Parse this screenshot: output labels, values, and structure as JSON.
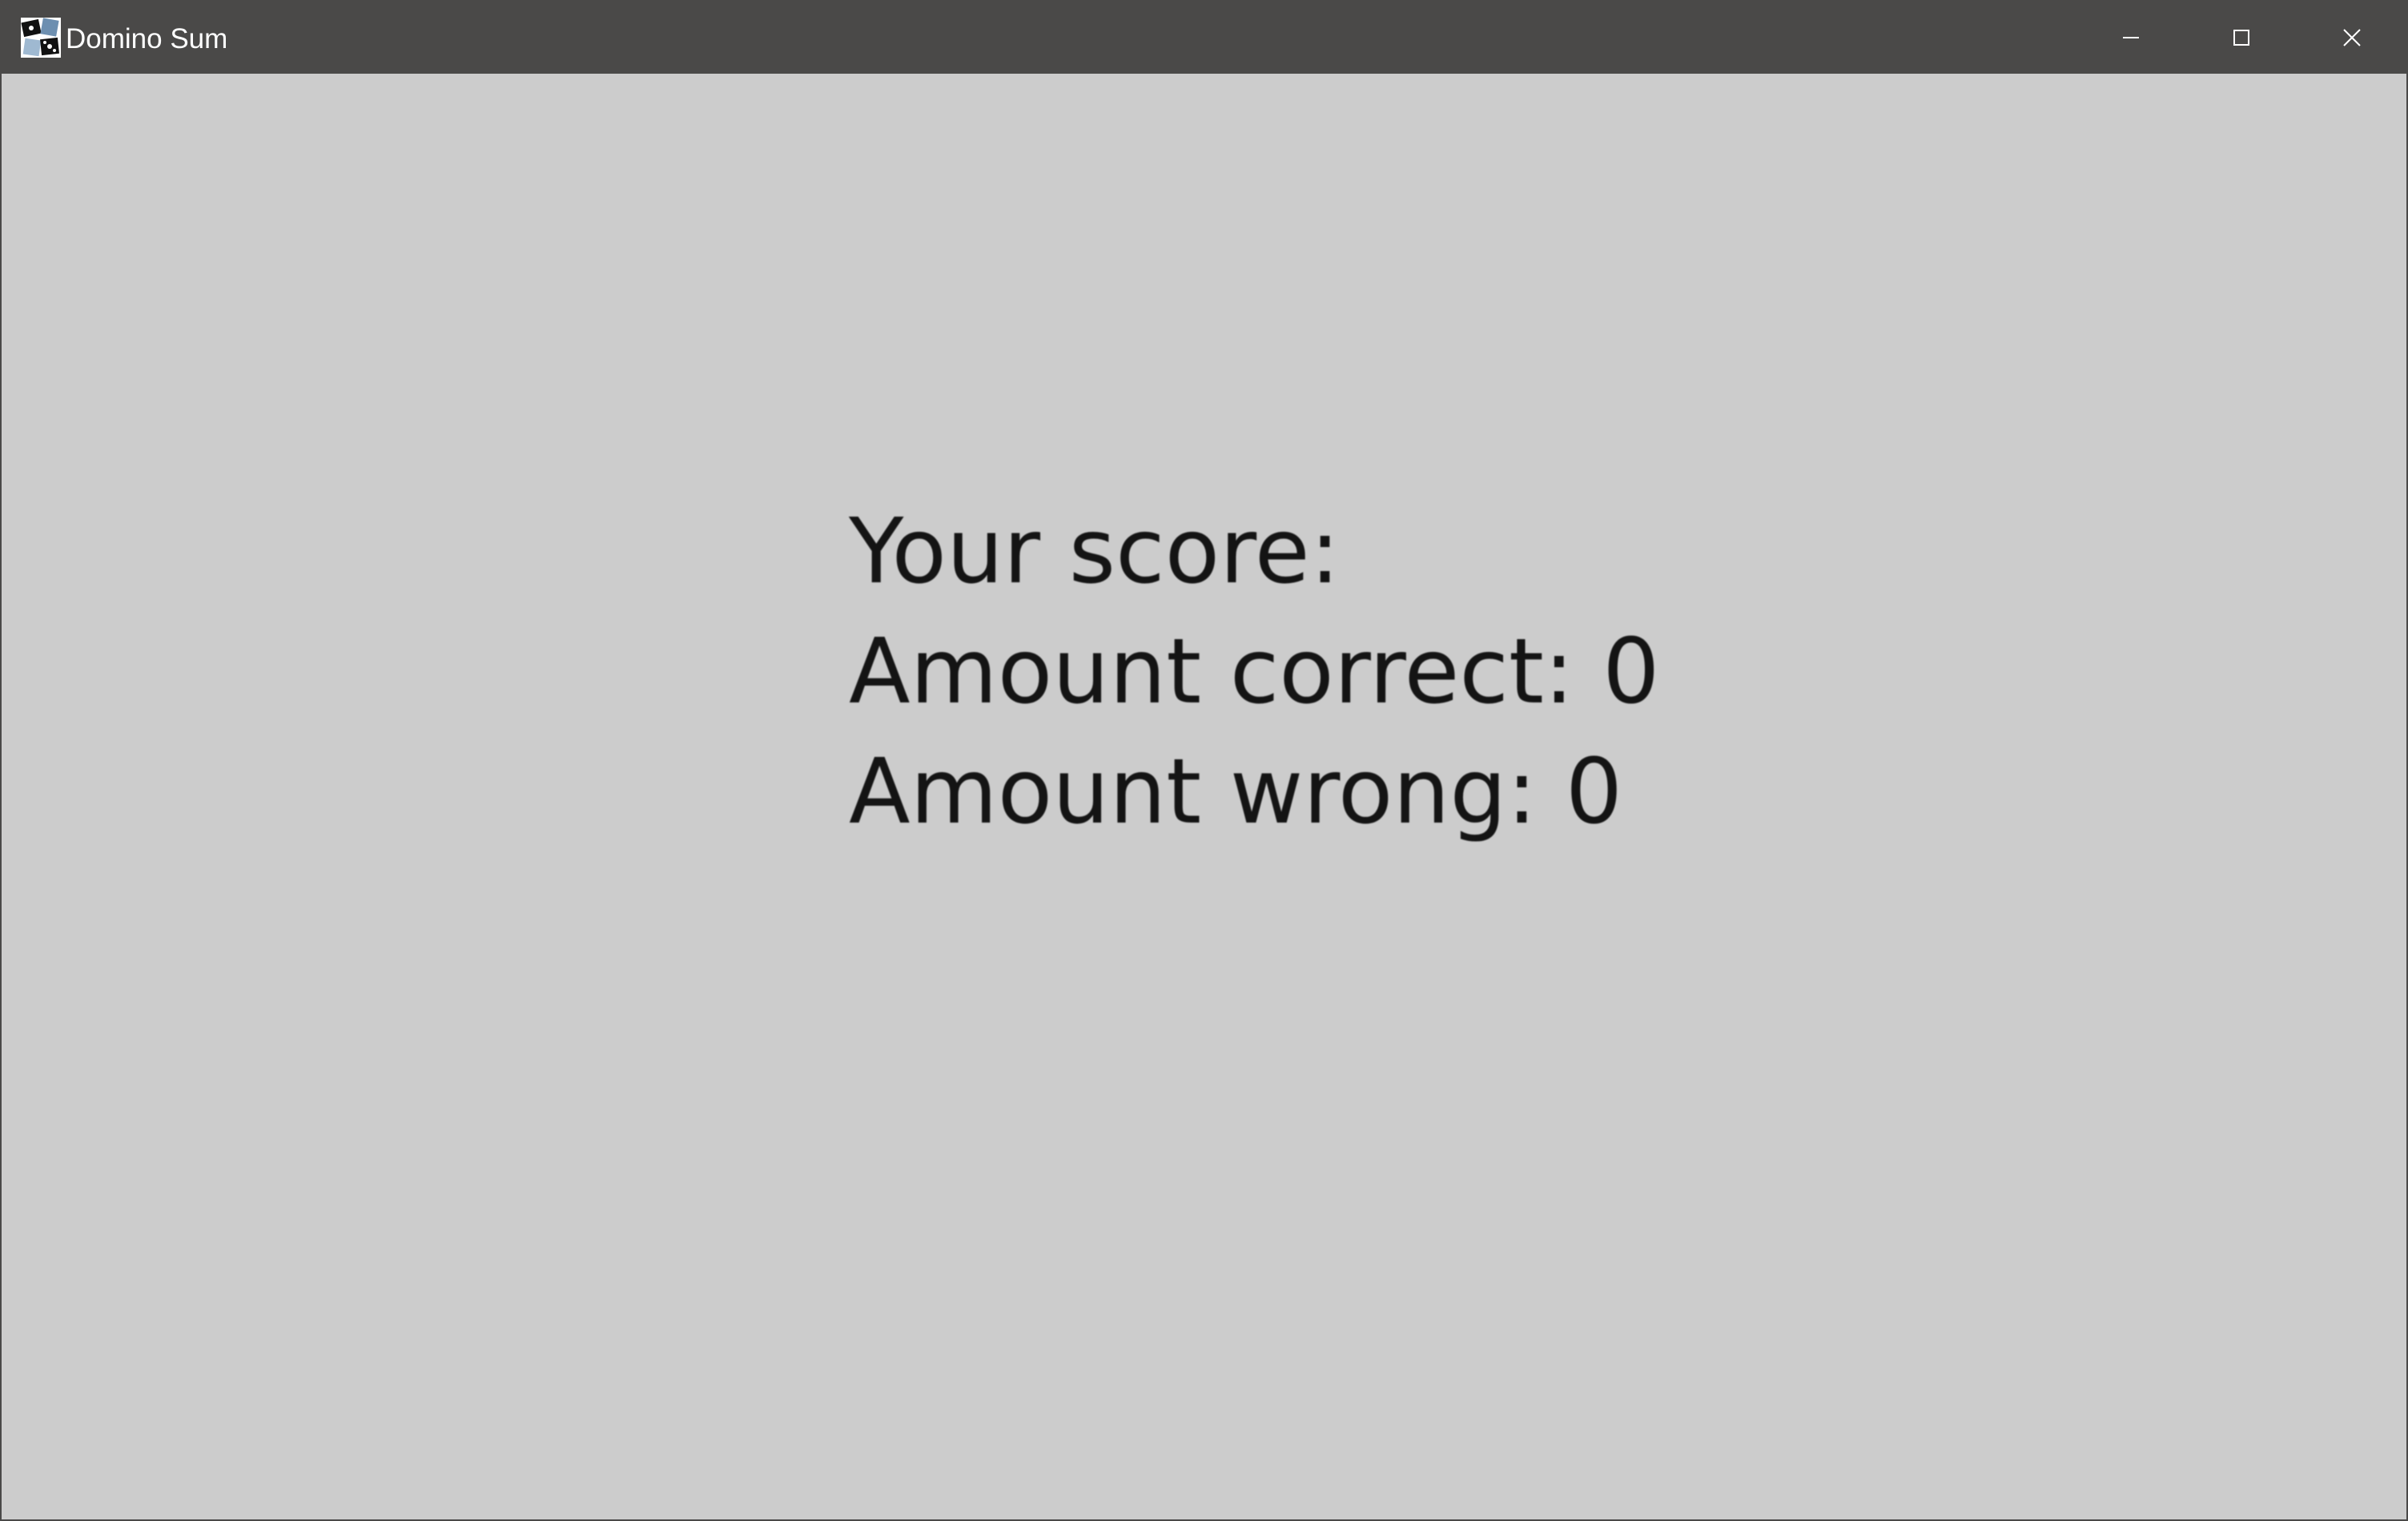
{
  "window": {
    "title": "Domino Sum",
    "controls": {
      "minimize_icon": "minimize-icon",
      "maximize_icon": "maximize-icon",
      "close_icon": "close-icon"
    }
  },
  "score": {
    "heading": "Your score:",
    "correct_label": "Amount correct: 0",
    "wrong_label": "Amount wrong: 0",
    "correct_value": 0,
    "wrong_value": 0
  },
  "colors": {
    "titlebar": "#4a4948",
    "background": "#cccccc",
    "text": "#141414"
  }
}
